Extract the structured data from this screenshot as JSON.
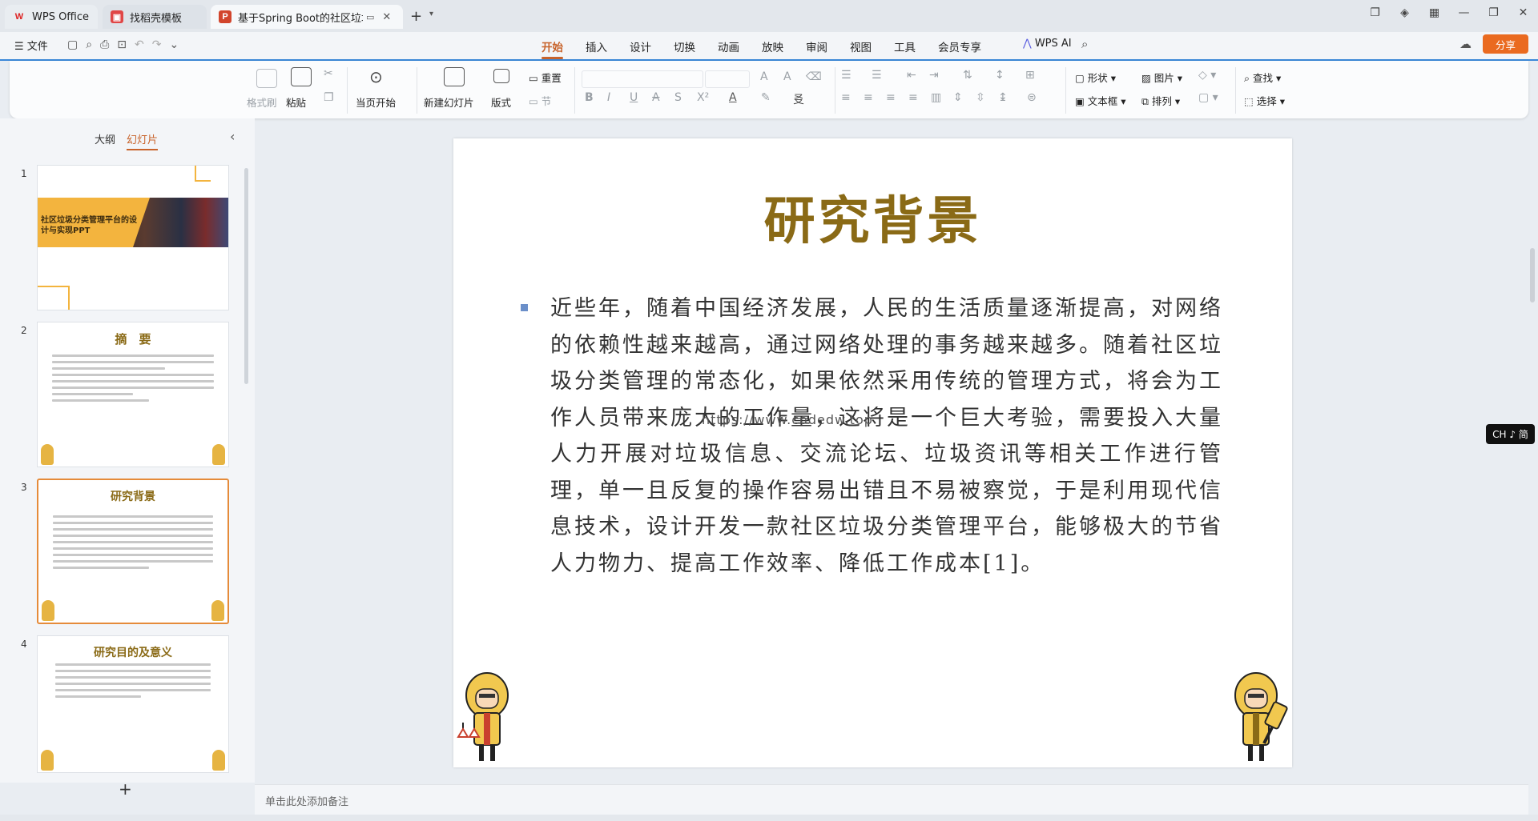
{
  "tabs": [
    {
      "label": "WPS Office",
      "icon": "wps-logo-icon"
    },
    {
      "label": "找稻壳模板",
      "icon": "docer-icon"
    },
    {
      "label": "基于Spring Boot的社区垃圾",
      "icon": "ppt-icon"
    }
  ],
  "menubar": {
    "file_label": "文件",
    "tabs": [
      "开始",
      "插入",
      "设计",
      "切换",
      "动画",
      "放映",
      "审阅",
      "视图",
      "工具",
      "会员专享"
    ],
    "active_tab": "开始",
    "wps_ai_label": "WPS AI",
    "share_label": "分享"
  },
  "ribbon": {
    "format_painter": "格式刷",
    "paste": "粘贴",
    "play_from_current": "当页开始",
    "new_slide": "新建幻灯片",
    "layout": "版式",
    "reset": "重置",
    "section": "节",
    "shape": "形状",
    "picture": "图片",
    "textbox": "文本框",
    "arrange": "排列",
    "find": "查找",
    "select": "选择"
  },
  "panel": {
    "tab_outline": "大纲",
    "tab_slides": "幻灯片",
    "active_tab": "幻灯片",
    "thumbnails": [
      {
        "number": "1",
        "title": "社区垃圾分类管理平台的设计与实现PPT"
      },
      {
        "number": "2",
        "title": "摘　要"
      },
      {
        "number": "3",
        "title": "研究背景"
      },
      {
        "number": "4",
        "title": "研究目的及意义"
      }
    ],
    "selected": "3"
  },
  "slide": {
    "title": "研究背景",
    "body": "近些年，随着中国经济发展，人民的生活质量逐渐提高，对网络的依赖性越来越高，通过网络处理的事务越来越多。随着社区垃圾分类管理的常态化，如果依然采用传统的管理方式，将会为工作人员带来庞大的工作量，这将是一个巨大考验，需要投入大量人力开展对垃圾信息、交流论坛、垃圾资讯等相关工作进行管理，单一且反复的操作容易出错且不易被察觉，于是利用现代信息技术，设计开发一款社区垃圾分类管理平台，能够极大的节省人力物力、提高工作效率、降低工作成本[1]。",
    "watermark": "https://www.codedw.top"
  },
  "notes_placeholder": "单击此处添加备注",
  "ime_indicator": "CH ♪ 简",
  "colors": {
    "accent": "#c8632b",
    "title_gold": "#8a6a16",
    "share_orange": "#ea6a20",
    "ribbon_line": "#3a87d8"
  }
}
